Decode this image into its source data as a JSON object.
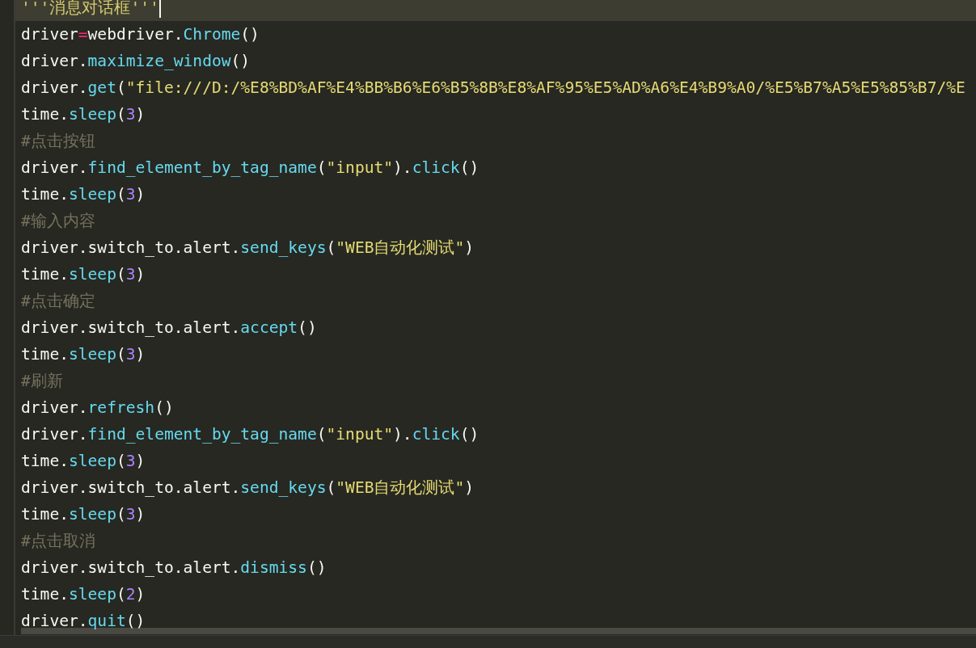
{
  "editor": {
    "lines": [
      {
        "current": true,
        "tokens": [
          {
            "kind": "docstring",
            "text": "'''消息对话框'''"
          }
        ]
      },
      {
        "current": false,
        "tokens": [
          {
            "kind": "plain",
            "text": "driver"
          },
          {
            "kind": "op",
            "text": "="
          },
          {
            "kind": "plain",
            "text": "webdriver."
          },
          {
            "kind": "call",
            "text": "Chrome"
          },
          {
            "kind": "plain",
            "text": "()"
          }
        ]
      },
      {
        "current": false,
        "tokens": [
          {
            "kind": "plain",
            "text": "driver."
          },
          {
            "kind": "call",
            "text": "maximize_window"
          },
          {
            "kind": "plain",
            "text": "()"
          }
        ]
      },
      {
        "current": false,
        "tokens": [
          {
            "kind": "plain",
            "text": "driver."
          },
          {
            "kind": "call",
            "text": "get"
          },
          {
            "kind": "plain",
            "text": "("
          },
          {
            "kind": "string",
            "text": "\"file:///D:/%E8%BD%AF%E4%BB%B6%E6%B5%8B%E8%AF%95%E5%AD%A6%E4%B9%A0/%E5%B7%A5%E5%85%B7/%E"
          }
        ]
      },
      {
        "current": false,
        "tokens": [
          {
            "kind": "plain",
            "text": "time."
          },
          {
            "kind": "call",
            "text": "sleep"
          },
          {
            "kind": "plain",
            "text": "("
          },
          {
            "kind": "number",
            "text": "3"
          },
          {
            "kind": "plain",
            "text": ")"
          }
        ]
      },
      {
        "current": false,
        "tokens": [
          {
            "kind": "comment",
            "text": "#点击按钮"
          }
        ]
      },
      {
        "current": false,
        "tokens": [
          {
            "kind": "plain",
            "text": "driver."
          },
          {
            "kind": "call",
            "text": "find_element_by_tag_name"
          },
          {
            "kind": "plain",
            "text": "("
          },
          {
            "kind": "string",
            "text": "\"input\""
          },
          {
            "kind": "plain",
            "text": ")."
          },
          {
            "kind": "call",
            "text": "click"
          },
          {
            "kind": "plain",
            "text": "()"
          }
        ]
      },
      {
        "current": false,
        "tokens": [
          {
            "kind": "plain",
            "text": "time."
          },
          {
            "kind": "call",
            "text": "sleep"
          },
          {
            "kind": "plain",
            "text": "("
          },
          {
            "kind": "number",
            "text": "3"
          },
          {
            "kind": "plain",
            "text": ")"
          }
        ]
      },
      {
        "current": false,
        "tokens": [
          {
            "kind": "comment",
            "text": "#输入内容"
          }
        ]
      },
      {
        "current": false,
        "tokens": [
          {
            "kind": "plain",
            "text": "driver.switch_to.alert."
          },
          {
            "kind": "call",
            "text": "send_keys"
          },
          {
            "kind": "plain",
            "text": "("
          },
          {
            "kind": "string",
            "text": "\"WEB自动化测试\""
          },
          {
            "kind": "plain",
            "text": ")"
          }
        ]
      },
      {
        "current": false,
        "tokens": [
          {
            "kind": "plain",
            "text": "time."
          },
          {
            "kind": "call",
            "text": "sleep"
          },
          {
            "kind": "plain",
            "text": "("
          },
          {
            "kind": "number",
            "text": "3"
          },
          {
            "kind": "plain",
            "text": ")"
          }
        ]
      },
      {
        "current": false,
        "tokens": [
          {
            "kind": "comment",
            "text": "#点击确定"
          }
        ]
      },
      {
        "current": false,
        "tokens": [
          {
            "kind": "plain",
            "text": "driver.switch_to.alert."
          },
          {
            "kind": "call",
            "text": "accept"
          },
          {
            "kind": "plain",
            "text": "()"
          }
        ]
      },
      {
        "current": false,
        "tokens": [
          {
            "kind": "plain",
            "text": "time."
          },
          {
            "kind": "call",
            "text": "sleep"
          },
          {
            "kind": "plain",
            "text": "("
          },
          {
            "kind": "number",
            "text": "3"
          },
          {
            "kind": "plain",
            "text": ")"
          }
        ]
      },
      {
        "current": false,
        "tokens": [
          {
            "kind": "comment",
            "text": "#刷新"
          }
        ]
      },
      {
        "current": false,
        "tokens": [
          {
            "kind": "plain",
            "text": "driver."
          },
          {
            "kind": "call",
            "text": "refresh"
          },
          {
            "kind": "plain",
            "text": "()"
          }
        ]
      },
      {
        "current": false,
        "tokens": [
          {
            "kind": "plain",
            "text": "driver."
          },
          {
            "kind": "call",
            "text": "find_element_by_tag_name"
          },
          {
            "kind": "plain",
            "text": "("
          },
          {
            "kind": "string",
            "text": "\"input\""
          },
          {
            "kind": "plain",
            "text": ")."
          },
          {
            "kind": "call",
            "text": "click"
          },
          {
            "kind": "plain",
            "text": "()"
          }
        ]
      },
      {
        "current": false,
        "tokens": [
          {
            "kind": "plain",
            "text": "time."
          },
          {
            "kind": "call",
            "text": "sleep"
          },
          {
            "kind": "plain",
            "text": "("
          },
          {
            "kind": "number",
            "text": "3"
          },
          {
            "kind": "plain",
            "text": ")"
          }
        ]
      },
      {
        "current": false,
        "tokens": [
          {
            "kind": "plain",
            "text": "driver.switch_to.alert."
          },
          {
            "kind": "call",
            "text": "send_keys"
          },
          {
            "kind": "plain",
            "text": "("
          },
          {
            "kind": "string",
            "text": "\"WEB自动化测试\""
          },
          {
            "kind": "plain",
            "text": ")"
          }
        ]
      },
      {
        "current": false,
        "tokens": [
          {
            "kind": "plain",
            "text": "time."
          },
          {
            "kind": "call",
            "text": "sleep"
          },
          {
            "kind": "plain",
            "text": "("
          },
          {
            "kind": "number",
            "text": "3"
          },
          {
            "kind": "plain",
            "text": ")"
          }
        ]
      },
      {
        "current": false,
        "tokens": [
          {
            "kind": "comment",
            "text": "#点击取消"
          }
        ]
      },
      {
        "current": false,
        "tokens": [
          {
            "kind": "plain",
            "text": "driver.switch_to.alert."
          },
          {
            "kind": "call",
            "text": "dismiss"
          },
          {
            "kind": "plain",
            "text": "()"
          }
        ]
      },
      {
        "current": false,
        "tokens": [
          {
            "kind": "plain",
            "text": "time."
          },
          {
            "kind": "call",
            "text": "sleep"
          },
          {
            "kind": "plain",
            "text": "("
          },
          {
            "kind": "number",
            "text": "2"
          },
          {
            "kind": "plain",
            "text": ")"
          }
        ]
      },
      {
        "current": false,
        "tokens": [
          {
            "kind": "plain",
            "text": "driver."
          },
          {
            "kind": "call",
            "text": "quit"
          },
          {
            "kind": "plain",
            "text": "()"
          }
        ]
      }
    ]
  }
}
